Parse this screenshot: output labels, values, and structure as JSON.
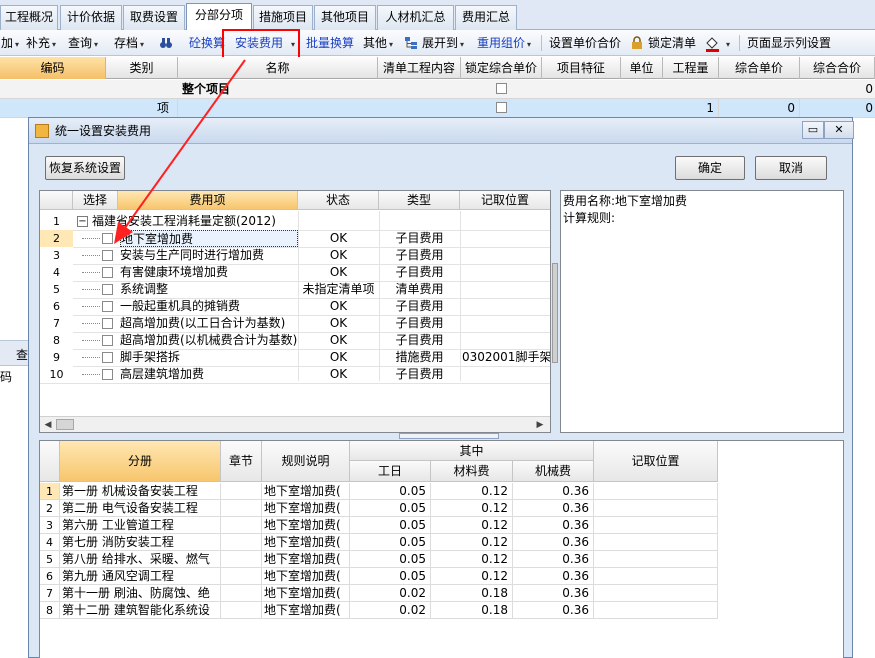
{
  "main_tabs": [
    "工程概况",
    "计价依据",
    "取费设置",
    "分部分项",
    "措施项目",
    "其他项目",
    "人材机汇总",
    "费用汇总"
  ],
  "active_tab": "分部分项",
  "toolbar": {
    "add": "加",
    "supplement": "补充",
    "query": "查询",
    "store": "存档",
    "concrete_convert": "砼换算",
    "install_fee": "安装费用",
    "batch_convert": "批量换算",
    "other": "其他",
    "expand_to": "展开到",
    "common_group_price": "重用组价",
    "set_unit_price": "设置单价合价",
    "lock_list": "锁定清单",
    "page_columns": "页面显示列设置",
    "colors": {
      "highlight_box": "#ff0000",
      "blue_text": "#1a3fbf"
    }
  },
  "main_grid": {
    "headers": [
      "编码",
      "类别",
      "名称",
      "清单工程内容",
      "锁定综合单价",
      "项目特征",
      "单位",
      "工程量",
      "综合单价",
      "综合合价"
    ],
    "rows": [
      {
        "code": "",
        "type": "",
        "name": "整个项目",
        "locked": false,
        "qty": "",
        "unit_price": "",
        "total": "0"
      },
      {
        "code": "",
        "type": "项",
        "name": "",
        "locked": false,
        "qty": "1",
        "unit_price": "0",
        "total": "0"
      }
    ]
  },
  "background_fragments": {
    "toolbar_fragment": "查",
    "column_fragment": "码"
  },
  "dialog": {
    "title": "统一设置安装费用",
    "restore_button": "恢复系统设置",
    "ok_button": "确定",
    "cancel_button": "取消",
    "fee_table": {
      "headers": [
        "选择",
        "费用项",
        "状态",
        "类型",
        "记取位置"
      ],
      "group": {
        "row_no": "1",
        "name": "福建省安装工程消耗量定额(2012)",
        "expand_symbol": "−"
      },
      "rows": [
        {
          "no": "2",
          "name": "地下室增加费",
          "status": "OK",
          "type": "子目费用",
          "position": ""
        },
        {
          "no": "3",
          "name": "安装与生产同时进行增加费",
          "status": "OK",
          "type": "子目费用",
          "position": ""
        },
        {
          "no": "4",
          "name": "有害健康环境增加费",
          "status": "OK",
          "type": "子目费用",
          "position": ""
        },
        {
          "no": "5",
          "name": "系统调整",
          "status": "未指定清单项",
          "type": "清单费用",
          "position": ""
        },
        {
          "no": "6",
          "name": "一般起重机具的摊销费",
          "status": "OK",
          "type": "子目费用",
          "position": ""
        },
        {
          "no": "7",
          "name": "超高增加费(以工日合计为基数)",
          "status": "OK",
          "type": "子目费用",
          "position": ""
        },
        {
          "no": "8",
          "name": "超高增加费(以机械费合计为基数)",
          "status": "OK",
          "type": "子目费用",
          "position": ""
        },
        {
          "no": "9",
          "name": "脚手架搭拆",
          "status": "OK",
          "type": "措施费用",
          "position": "0302001脚手架"
        },
        {
          "no": "10",
          "name": "高层建筑增加费",
          "status": "OK",
          "type": "子目费用",
          "position": ""
        }
      ]
    },
    "info": {
      "fee_name_label": "费用名称:",
      "fee_name": "地下室增加费",
      "rule_label": "计算规则:"
    },
    "rule_table": {
      "headers": {
        "volume": "分册",
        "chapter": "章节",
        "rule": "规则说明",
        "among": "其中",
        "labor": "工日",
        "material": "材料费",
        "machine": "机械费",
        "position": "记取位置"
      },
      "rows": [
        {
          "no": "1",
          "volume": "第一册 机械设备安装工程",
          "rule": "地下室增加费(",
          "labor": "0.05",
          "material": "0.12",
          "machine": "0.36"
        },
        {
          "no": "2",
          "volume": "第二册 电气设备安装工程",
          "rule": "地下室增加费(",
          "labor": "0.05",
          "material": "0.12",
          "machine": "0.36"
        },
        {
          "no": "3",
          "volume": "第六册 工业管道工程",
          "rule": "地下室增加费(",
          "labor": "0.05",
          "material": "0.12",
          "machine": "0.36"
        },
        {
          "no": "4",
          "volume": "第七册 消防安装工程",
          "rule": "地下室增加费(",
          "labor": "0.05",
          "material": "0.12",
          "machine": "0.36"
        },
        {
          "no": "5",
          "volume": "第八册 给排水、采暖、燃气",
          "rule": "地下室增加费(",
          "labor": "0.05",
          "material": "0.12",
          "machine": "0.36"
        },
        {
          "no": "6",
          "volume": "第九册 通风空调工程",
          "rule": "地下室增加费(",
          "labor": "0.05",
          "material": "0.12",
          "machine": "0.36"
        },
        {
          "no": "7",
          "volume": "第十一册 刷油、防腐蚀、绝",
          "rule": "地下室增加费(",
          "labor": "0.02",
          "material": "0.18",
          "machine": "0.36"
        },
        {
          "no": "8",
          "volume": "第十二册 建筑智能化系统设",
          "rule": "地下室增加费(",
          "labor": "0.02",
          "material": "0.18",
          "machine": "0.36"
        }
      ]
    }
  },
  "annotation": {
    "arrow_color": "#ff2020"
  }
}
